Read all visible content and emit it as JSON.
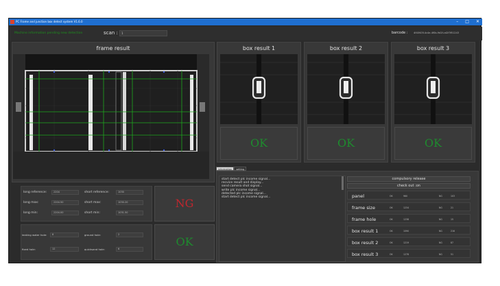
{
  "window": {
    "title": "PC Frame and junction box detect system V1.6.0",
    "min": "–",
    "max": "□",
    "close": "✕"
  },
  "toolbar": {
    "status_text": "Machine information pending new detection",
    "scan_label": "scan :",
    "scan_value": "1",
    "barcode_label": "barcode :",
    "barcode_value": "4f40f43f-4c4e-4f0b-9d2f-cd2f3f51243"
  },
  "frame": {
    "title": "frame result",
    "result": "NG",
    "long_reference_label": "long reference:",
    "long_reference_value": "2204",
    "short_reference_label": "short reference:",
    "short_reference_value": "1030",
    "long_max_label": "long max:",
    "long_max_value": "2204.50",
    "short_max_label": "short max:",
    "short_max_value": "1030.20",
    "long_min_label": "long min:",
    "long_min_value": "2204.00",
    "short_min_label": "short min:",
    "short_min_value": "1031.50",
    "hole_result": "OK",
    "leaking_water_hole_label": "leaking water hole:",
    "leaking_water_hole_value": "8",
    "ground_hole_label": "ground hole:",
    "ground_hole_value": "2",
    "fixed_hole_label": "fixed hole:",
    "fixed_hole_value": "12",
    "quicksand_hole_label": "quicksand hole:",
    "quicksand_hole_value": "6"
  },
  "boxes": [
    {
      "title": "box result 1",
      "result": "OK"
    },
    {
      "title": "box result 2",
      "result": "OK"
    },
    {
      "title": "box result 3",
      "result": "OK"
    }
  ],
  "tabs": [
    {
      "label": "information"
    },
    {
      "label": "setting"
    }
  ],
  "log": [
    "start detect plc income signal...",
    "recvice result and display...",
    "send camera shot signal...",
    "write plc income signal...",
    "detected plc income signal...",
    "start detect plc income signal..."
  ],
  "buttons": {
    "compulsory_release": "compulsory release",
    "check_out": "check out :on"
  },
  "stats": [
    {
      "name": "panel",
      "ok_label": "OK",
      "ok_value": "960",
      "ng_label": "NG",
      "ng_value": "103"
    },
    {
      "name": "frame size",
      "ok_label": "OK",
      "ok_value": "1234",
      "ng_label": "NG",
      "ng_value": "21"
    },
    {
      "name": "frame hole",
      "ok_label": "OK",
      "ok_value": "1238",
      "ng_label": "NG",
      "ng_value": "15"
    },
    {
      "name": "box result 1",
      "ok_label": "OK",
      "ok_value": "1090",
      "ng_label": "NG",
      "ng_value": "216"
    },
    {
      "name": "box result 2",
      "ok_label": "OK",
      "ok_value": "1219",
      "ng_label": "NG",
      "ng_value": "87"
    },
    {
      "name": "box result 3",
      "ok_label": "OK",
      "ok_value": "1278",
      "ng_label": "NG",
      "ng_value": "51"
    }
  ],
  "colors": {
    "ok": "#1e8a2e",
    "ng": "#c0262e",
    "titlebar": "#1f6fd0",
    "overlay_lines": "#1ea81e"
  }
}
